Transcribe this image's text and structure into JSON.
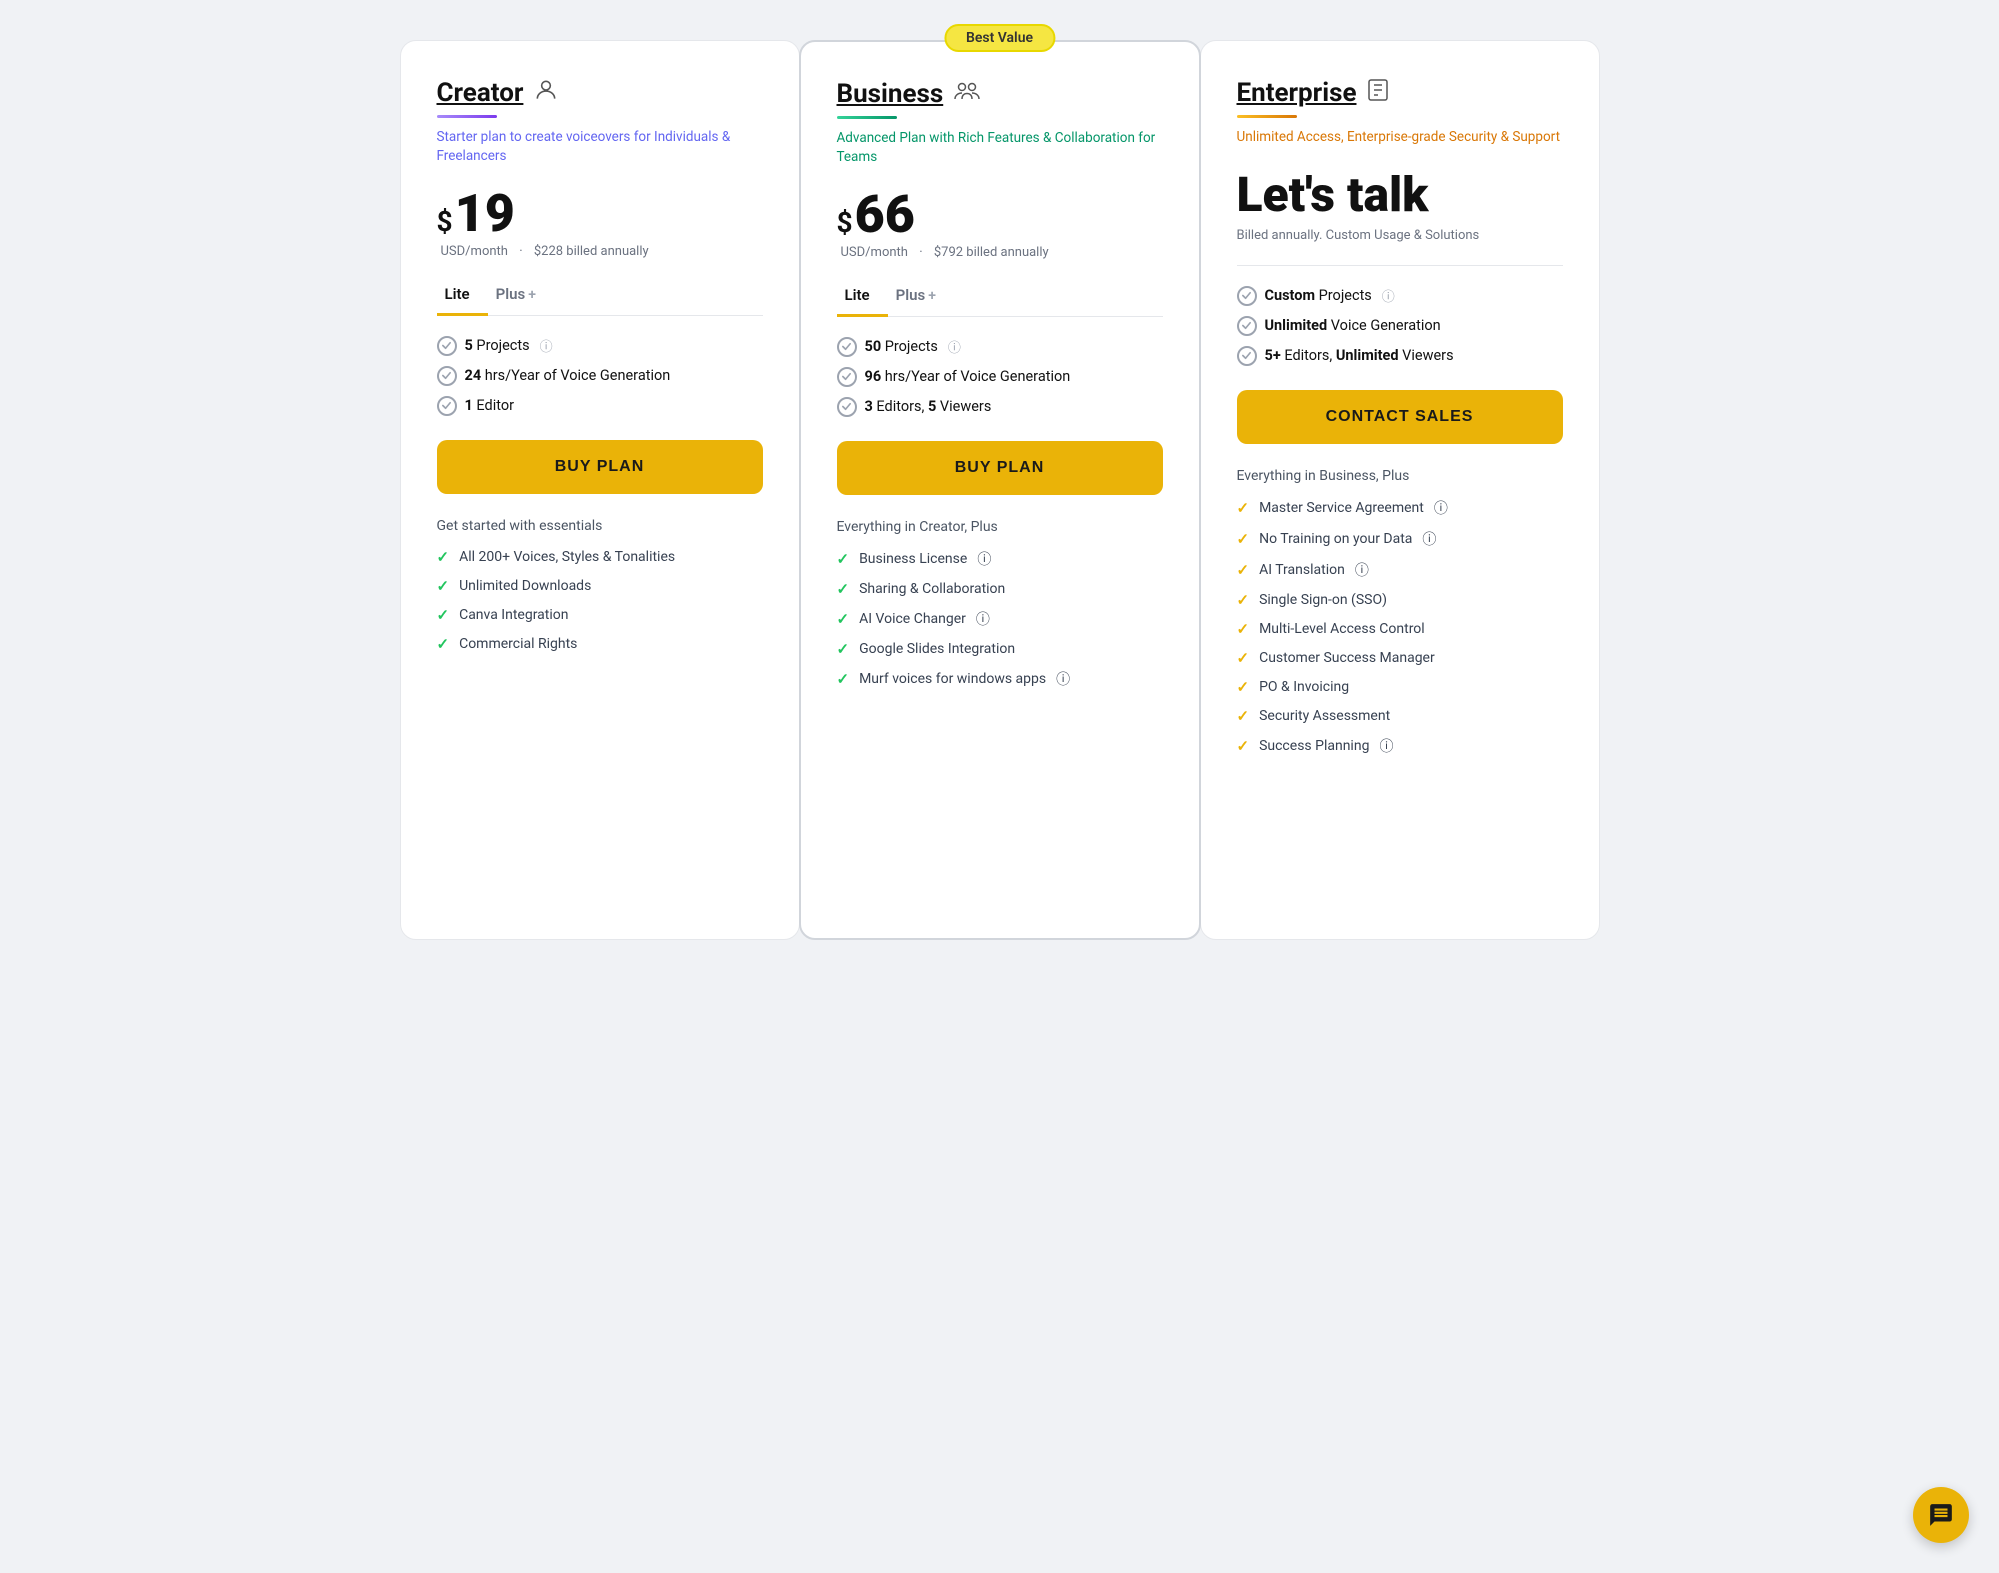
{
  "creator": {
    "name": "Creator",
    "subtitle": "Starter plan to create voiceovers for Individuals & Freelancers",
    "price_dollar": "$",
    "price": "19",
    "price_meta_usd": "USD/month",
    "price_meta_dot": "·",
    "price_meta_annual": "$228 billed annually",
    "tabs": [
      {
        "label": "Lite",
        "active": true
      },
      {
        "label": "Plus",
        "active": false,
        "plus": "+"
      }
    ],
    "features": [
      {
        "num": "5",
        "text": " Projects",
        "info": true
      },
      {
        "num": "24",
        "text": " hrs/Year of Voice Generation",
        "info": false
      },
      {
        "num": "1",
        "text": " Editor",
        "info": false
      }
    ],
    "btn_label": "BUY PLAN",
    "extras_title": "Get started with essentials",
    "extras": [
      {
        "text": "All 200+ Voices, Styles & Tonalities",
        "color": "green"
      },
      {
        "text": "Unlimited Downloads",
        "color": "green"
      },
      {
        "text": "Canva Integration",
        "color": "green"
      },
      {
        "text": "Commercial Rights",
        "color": "green"
      }
    ]
  },
  "business": {
    "name": "Business",
    "badge": "Best Value",
    "subtitle": "Advanced Plan with Rich Features & Collaboration for Teams",
    "price_dollar": "$",
    "price": "66",
    "price_meta_usd": "USD/month",
    "price_meta_dot": "·",
    "price_meta_annual": "$792 billed annually",
    "tabs": [
      {
        "label": "Lite",
        "active": true
      },
      {
        "label": "Plus",
        "active": false,
        "plus": "+"
      }
    ],
    "features": [
      {
        "num": "50",
        "text": " Projects",
        "info": true
      },
      {
        "num": "96",
        "text": " hrs/Year of Voice Generation",
        "info": false
      },
      {
        "num": "3",
        "text": " Editors,  ",
        "bold2": "5",
        "text2": " Viewers",
        "info": false
      }
    ],
    "btn_label": "BUY PLAN",
    "extras_title": "Everything in Creator, Plus",
    "extras": [
      {
        "text": "Business License",
        "color": "green",
        "info": true
      },
      {
        "text": "Sharing & Collaboration",
        "color": "green"
      },
      {
        "text": "AI Voice Changer",
        "color": "green",
        "info": true
      },
      {
        "text": "Google Slides Integration",
        "color": "green"
      },
      {
        "text": "Murf voices for windows apps",
        "color": "green",
        "info": true
      }
    ]
  },
  "enterprise": {
    "name": "Enterprise",
    "subtitle": "Unlimited Access, Enterprise-grade Security & Support",
    "lets_talk": "Let's talk",
    "billed_note": "Billed annually. Custom Usage & Solutions",
    "features": [
      {
        "bold": "Custom",
        "text": " Projects",
        "info": true
      },
      {
        "bold": "Unlimited",
        "text": " Voice Generation",
        "info": false
      },
      {
        "bold": "5+",
        "text": " Editors,  ",
        "bold2": "Unlimited",
        "text2": " Viewers",
        "info": false
      }
    ],
    "btn_label": "CONTACT SALES",
    "extras_title": "Everything in Business, Plus",
    "extras": [
      {
        "text": "Master Service Agreement",
        "color": "yellow",
        "info": true
      },
      {
        "text": "No Training on your Data",
        "color": "yellow",
        "info": true
      },
      {
        "text": "AI Translation",
        "color": "yellow",
        "info": true
      },
      {
        "text": "Single Sign-on (SSO)",
        "color": "yellow"
      },
      {
        "text": "Multi-Level Access Control",
        "color": "yellow"
      },
      {
        "text": "Customer Success Manager",
        "color": "yellow"
      },
      {
        "text": "PO & Invoicing",
        "color": "yellow"
      },
      {
        "text": "Security Assessment",
        "color": "yellow"
      },
      {
        "text": "Success Planning",
        "color": "yellow",
        "info": true
      }
    ]
  }
}
